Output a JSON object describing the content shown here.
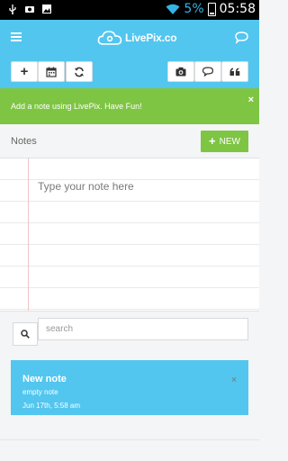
{
  "status_bar": {
    "battery_percent": "5%",
    "time": "05:58",
    "icons": [
      "usb-icon",
      "screenshot-icon",
      "image-icon",
      "wifi-icon",
      "battery-icon"
    ]
  },
  "app_bar": {
    "logo_text": "LivePix.co",
    "accent_color": "#52c6ef",
    "icons": [
      "menu-icon",
      "chat-icon"
    ]
  },
  "toolbar": {
    "left_buttons": [
      {
        "name": "add-button",
        "glyph": "+"
      },
      {
        "name": "calendar-button",
        "glyph": "calendar-icon"
      },
      {
        "name": "refresh-button",
        "glyph": "refresh-icon"
      }
    ],
    "right_buttons": [
      {
        "name": "camera-button",
        "glyph": "camera-icon"
      },
      {
        "name": "comment-button",
        "glyph": "comment-icon"
      },
      {
        "name": "quote-button",
        "glyph": "quote-icon"
      }
    ]
  },
  "notice": {
    "text": "Add a note using LivePix. Have Fun!",
    "close": "×",
    "color": "#7fc544"
  },
  "notes": {
    "title": "Notes",
    "new_button": "NEW",
    "new_plus": "+",
    "placeholder": "Type your note here"
  },
  "search": {
    "placeholder": "search"
  },
  "list": {
    "items": [
      {
        "title": "New note",
        "body": "empty note",
        "date": "Jun 17th, 5:58 am",
        "close": "×"
      }
    ]
  }
}
